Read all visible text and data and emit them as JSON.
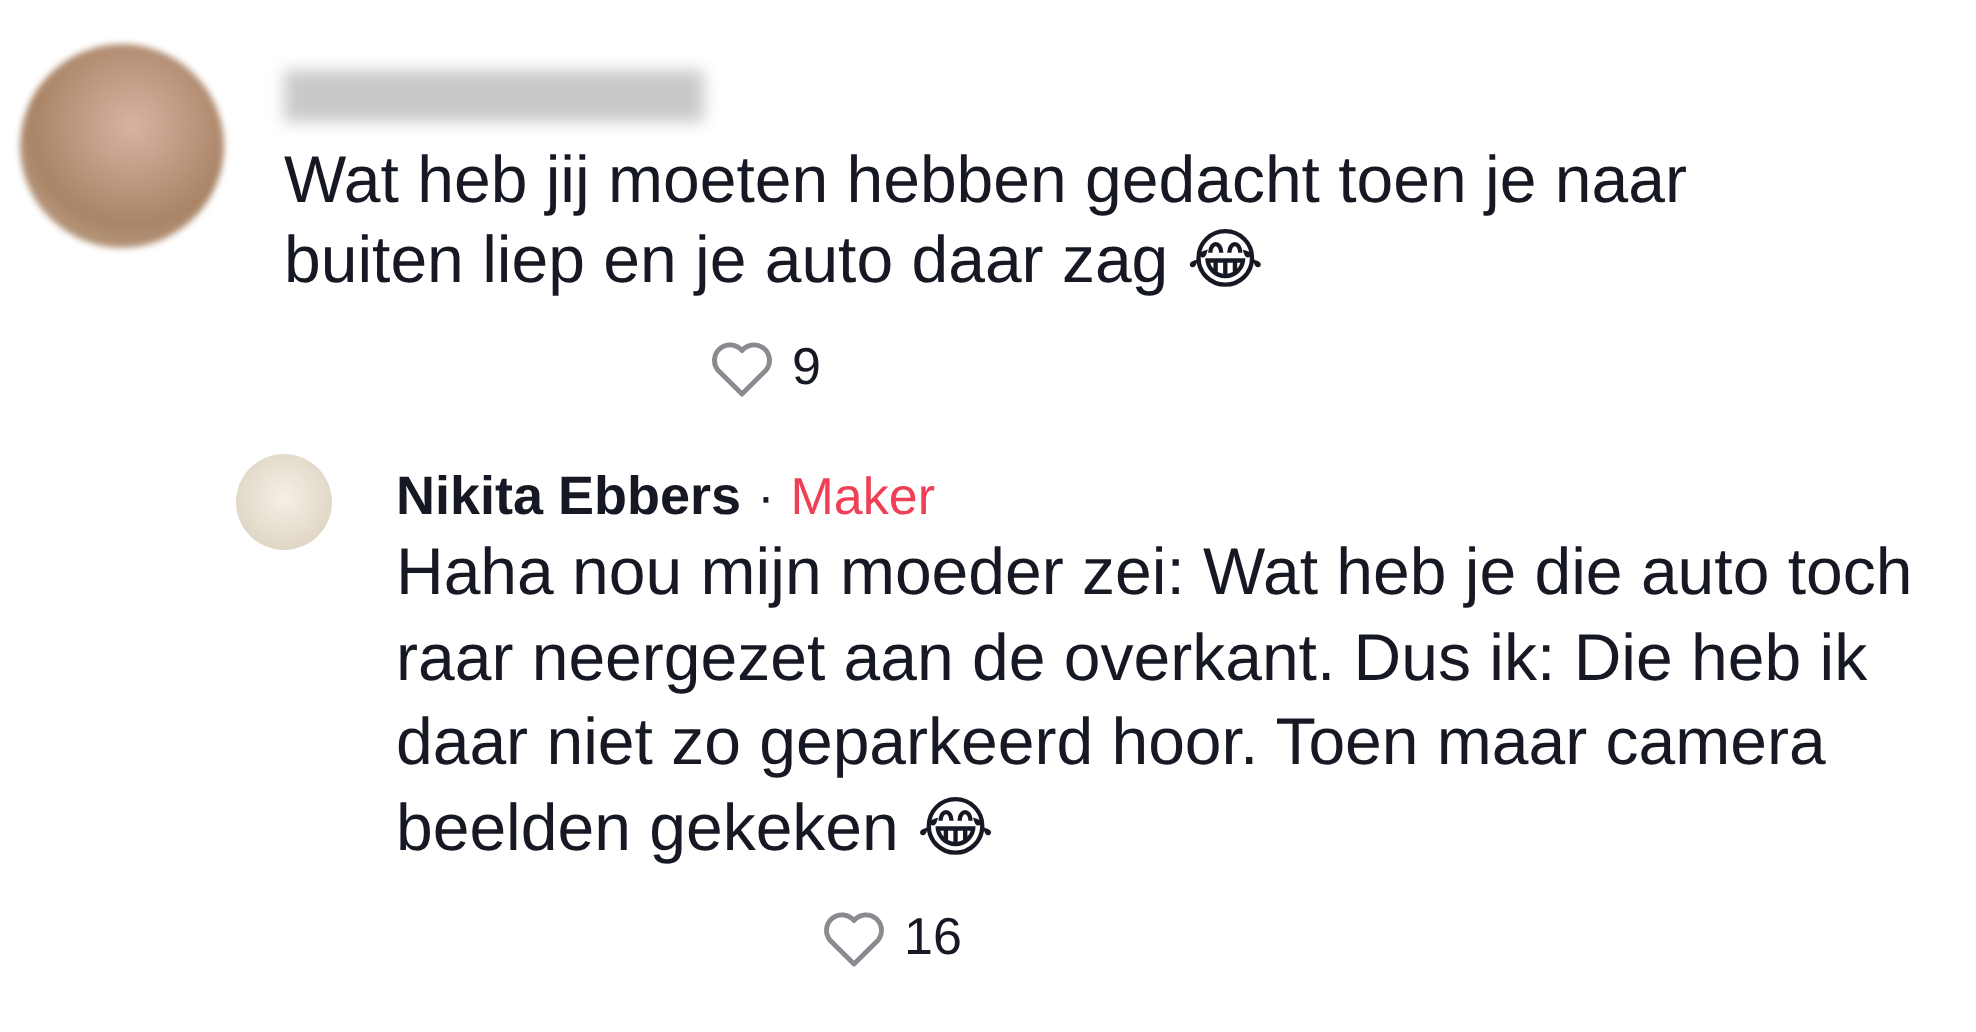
{
  "comments": [
    {
      "author_hidden": true,
      "text": "Wat heb jij moeten hebben gedacht toen je naar buiten liep en je auto daar zag 😂",
      "likes": "9",
      "liked": false,
      "reply": false
    },
    {
      "author_hidden": false,
      "author": "Nikita Ebbers",
      "separator": "·",
      "badge": "Maker",
      "text": "Haha nou mijn moeder zei: Wat heb je die auto toch raar neergezet aan de overkant. Dus ik: Die heb ik daar niet zo geparkeerd hoor. Toen maar camera beelden gekeken 😂",
      "likes": "16",
      "liked": false,
      "reply": true
    }
  ]
}
